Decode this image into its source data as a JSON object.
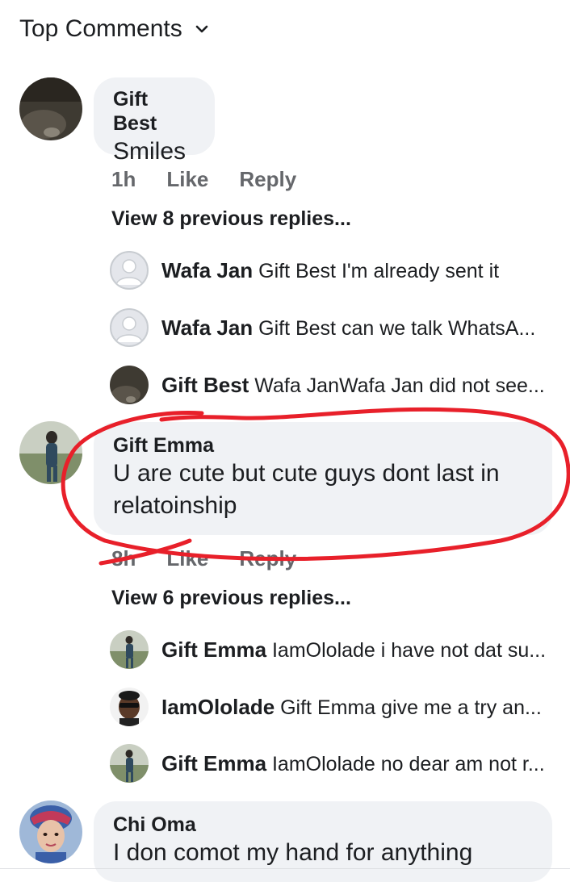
{
  "header": {
    "title": "Top Comments"
  },
  "comments": [
    {
      "author": "Gift Best",
      "text": "Smiles",
      "time": "1h",
      "like_label": "Like",
      "reply_label": "Reply",
      "view_previous": "View 8 previous replies...",
      "replies": [
        {
          "author": "Wafa Jan",
          "text": "Gift Best I'm already sent it"
        },
        {
          "author": "Wafa Jan",
          "text": "Gift Best can we talk WhatsA..."
        },
        {
          "author": "Gift Best",
          "text": "Wafa JanWafa Jan did not see..."
        }
      ]
    },
    {
      "author": "Gift Emma",
      "text_line1": "U are cute but cute guys dont last in",
      "text_line2": "relatoinship",
      "time": "8h",
      "like_label": "Like",
      "reply_label": "Reply",
      "view_previous": "View 6 previous replies...",
      "replies": [
        {
          "author": "Gift Emma",
          "text": "IamOlolade i have not dat su..."
        },
        {
          "author": "IamOlolade",
          "text": "Gift Emma give me a try an..."
        },
        {
          "author": "Gift Emma",
          "text": "IamOlolade no dear am not r..."
        }
      ]
    },
    {
      "author": "Chi Oma",
      "text": "I don comot my hand for anything"
    }
  ],
  "colors": {
    "bubble": "#f0f2f5",
    "muted": "#65676b",
    "annotation": "#e8202a"
  }
}
